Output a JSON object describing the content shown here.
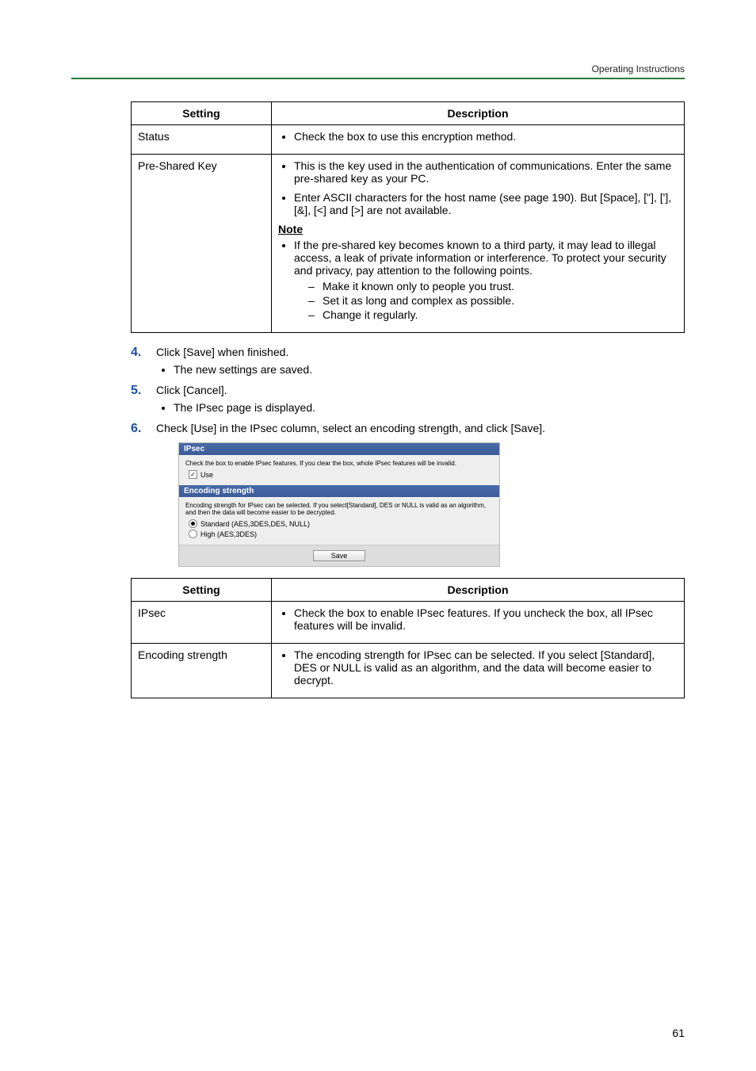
{
  "header": {
    "doc_title": "Operating Instructions"
  },
  "table1": {
    "headers": {
      "setting": "Setting",
      "description": "Description"
    },
    "rows": [
      {
        "setting": "Status",
        "bullets": [
          "Check the box to use this encryption method."
        ]
      },
      {
        "setting": "Pre-Shared Key",
        "bullets": [
          "This is the key used in the authentication of communications. Enter the same pre-shared key as your PC.",
          "Enter ASCII characters for the host name (see page 190). But [Space], [\"], ['], [&], [<] and [>] are not available."
        ],
        "note_label": "Note",
        "note_bullets": [
          "If the pre-shared key becomes known to a third party, it may lead to illegal access, a leak of private information or interference. To protect your security and privacy, pay attention to the following points."
        ],
        "note_dashes": [
          "Make it known only to people you trust.",
          "Set it as long and complex as possible.",
          "Change it regularly."
        ]
      }
    ]
  },
  "steps": {
    "s4": {
      "num": "4.",
      "text": "Click [Save] when finished.",
      "sub": [
        "The new settings are saved."
      ]
    },
    "s5": {
      "num": "5.",
      "text": "Click [Cancel].",
      "sub": [
        "The IPsec page is displayed."
      ]
    },
    "s6": {
      "num": "6.",
      "text": "Check [Use] in the IPsec column, select an encoding strength, and click [Save]."
    }
  },
  "screenshot": {
    "ipsec_title": "IPsec",
    "ipsec_hint": "Check the box to enable IPsec features. If you clear the box, whole IPsec features will be invalid.",
    "use_label": "Use",
    "enc_title": "Encoding strength",
    "enc_hint": "Encoding strength for IPsec can be selected. If you select[Standard], DES or NULL is valid as an algorithm, and then the data will become easier to be decrypted.",
    "radio_standard": "Standard (AES,3DES,DES, NULL)",
    "radio_high": "High (AES,3DES)",
    "save_btn": "Save"
  },
  "table2": {
    "headers": {
      "setting": "Setting",
      "description": "Description"
    },
    "rows": [
      {
        "setting": "IPsec",
        "bullets": [
          "Check the box to enable IPsec features. If you uncheck the box, all IPsec features will be invalid."
        ]
      },
      {
        "setting": "Encoding strength",
        "bullets": [
          "The encoding strength for IPsec can be selected. If you select [Standard], DES or NULL is valid as an algorithm, and the data will become easier to decrypt."
        ]
      }
    ]
  },
  "page_number": "61"
}
